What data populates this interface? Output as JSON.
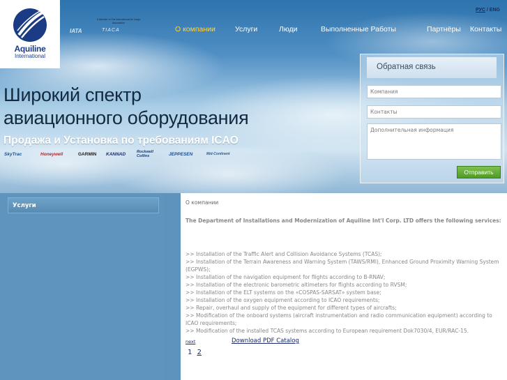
{
  "brand": {
    "name": "Aquiline",
    "sub": "International"
  },
  "associations": {
    "note": "A Member of The International Air Cargo Association",
    "iata": "IATA",
    "tiaca": "TIACA"
  },
  "lang": {
    "ru": "РУС",
    "sep": "/",
    "en": "ENG"
  },
  "nav": [
    "О компании",
    "Услуги",
    "Люди",
    "Выполненные Работы",
    "Партнёры",
    "Контакты"
  ],
  "hero": {
    "title_line1": "Широкий спектр",
    "title_line2": "авиационного оборудования",
    "subtitle": "Продажа и Установка по требованиям ICAO"
  },
  "brands": [
    "SkyTrac",
    "Honeywell",
    "GARMIN",
    "KANNAD",
    "Rockwell Collins",
    "JEPPESEN",
    "Mid-Continent"
  ],
  "form": {
    "title": "Обратная связь",
    "company_placeholder": "Компания",
    "contacts_placeholder": "Контакты",
    "info_placeholder": "Дополнительная информация",
    "send": "Отправить"
  },
  "sidebar": {
    "heading": "Услуги"
  },
  "content": {
    "breadcrumb": "О компании",
    "intro": "The Department of Installations and Modernization of Aquiline Int'l Corp. LTD offers the following services:",
    "services": [
      ">> Installation of the Traffic Alert and Collision Avoidance Systems (TCAS);",
      ">> Installation of the Terrain Awareness and Warning System (TAWS/RMI), Enhanced Ground Proximity Warning System (EGPWS);",
      ">> Installation of the navigation equipment for flights according to B-RNAV;",
      ">> Installation of the electronic barometric altimeters for flights according to RVSM;",
      ">> Installation of the ELT systems on the «COSPAS-SARSAT» system base;",
      ">> Installation of the oxygen equipment according to ICAO requirements;",
      ">> Repair, overhaul and supply of the equipment for different types of aircrafts;",
      ">> Modification of the onboard systems (aircraft instrumentation and radio communication equipment) according to ICAO requirements;",
      ">> Modification of the installed TCAS systems according to European requirement Dok7030/4, EUR/RAC-15."
    ],
    "next": "next",
    "pdf": "Download PDF Catalog",
    "pages": [
      "1",
      "2"
    ]
  }
}
